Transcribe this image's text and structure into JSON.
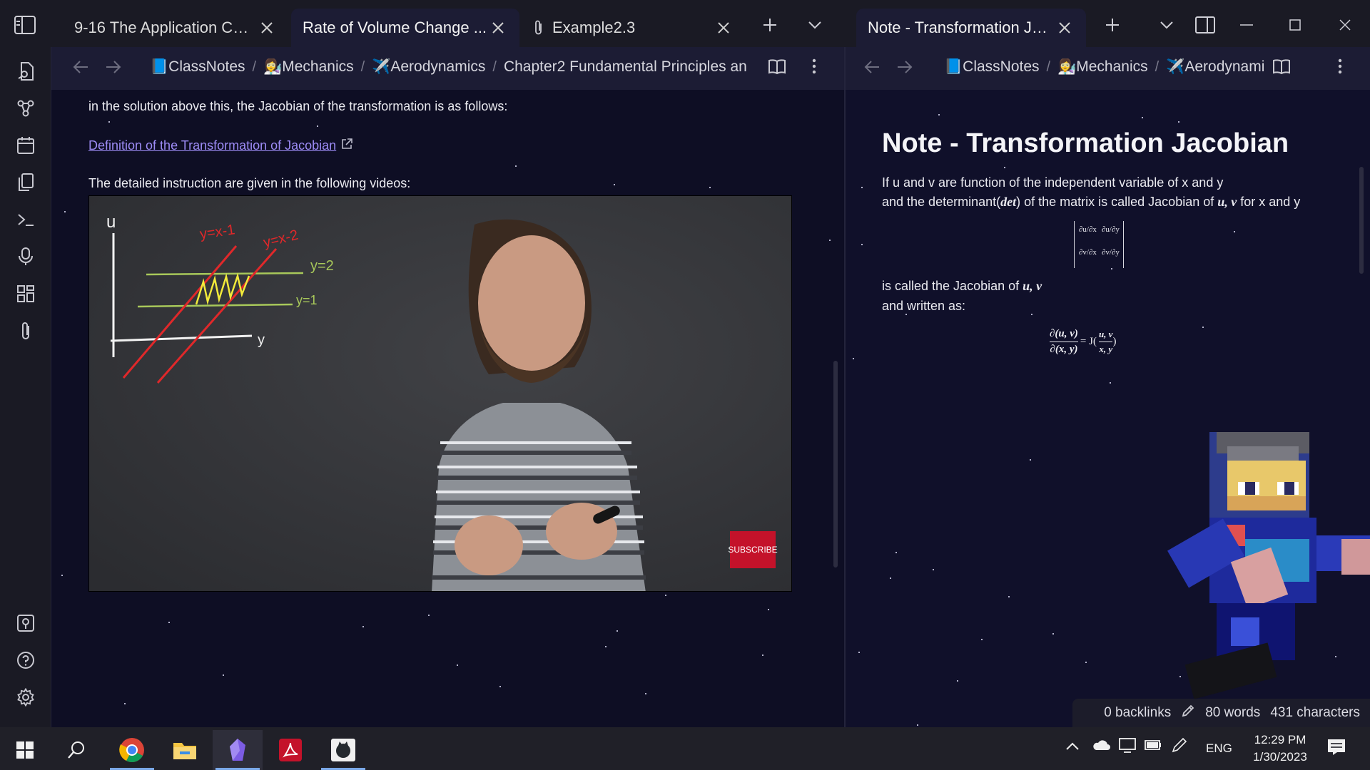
{
  "tabs": [
    {
      "label": "9-16 The Application Con...",
      "active": false
    },
    {
      "label": "Rate of Volume Change ...",
      "active": true
    },
    {
      "label": "Example2.3",
      "active": false,
      "icon": "paperclip-icon"
    }
  ],
  "right_tab": {
    "label": "Note - Transformation Jac..."
  },
  "breadcrumb_left": [
    "📘ClassNotes",
    "👩‍🔬Mechanics",
    "✈️Aerodynamics",
    "Chapter2 Fundamental Principles an"
  ],
  "breadcrumb_right": [
    "📘ClassNotes",
    "👩‍🔬Mechanics",
    "✈️Aerodynamic"
  ],
  "left_note": {
    "line1": "in the solution above this, the Jacobian of the transformation is as follows:",
    "link": "Definition of the Transformation of Jacobian",
    "line2": "The detailed instruction are given in the following videos:"
  },
  "video": {
    "board_labels": {
      "u": "u",
      "y_axis": "y",
      "l1": "y=x-1",
      "l2": "y=x-2",
      "l3": "y=2",
      "l4": "y=1"
    },
    "subscribe": "SUBSCRIBE"
  },
  "right_note": {
    "title": "Note - Transformation Jacobian",
    "line1": "If u and v are function  of the independent variable of x and y",
    "line2a": "and the determinant(",
    "line2_det": "det",
    "line2b": ") of the matrix is called Jacobian of ",
    "line2_uv": "u, v",
    "line2c": " for x and y",
    "matrix": {
      "a": "∂u/∂x",
      "b": "∂u/∂y",
      "c": "∂v/∂x",
      "d": "∂v/∂y"
    },
    "line3a": "is called the Jacobian of ",
    "line3_uv": "u, v",
    "line4": "and written as:",
    "formula": {
      "num": "∂(u, v)",
      "den": "∂(x, y)",
      "eq": "= J(",
      "fnum": "u, v",
      "fden": "x, y",
      "close": ")"
    }
  },
  "status": {
    "backlinks": "0 backlinks",
    "words": "80 words",
    "chars": "431 characters"
  },
  "tray": {
    "lang": "ENG",
    "time": "12:29 PM",
    "date": "1/30/2023"
  },
  "colors": {
    "accent": "#9d8cf6",
    "subscribe": "#c4122a",
    "board": "#35363a"
  }
}
